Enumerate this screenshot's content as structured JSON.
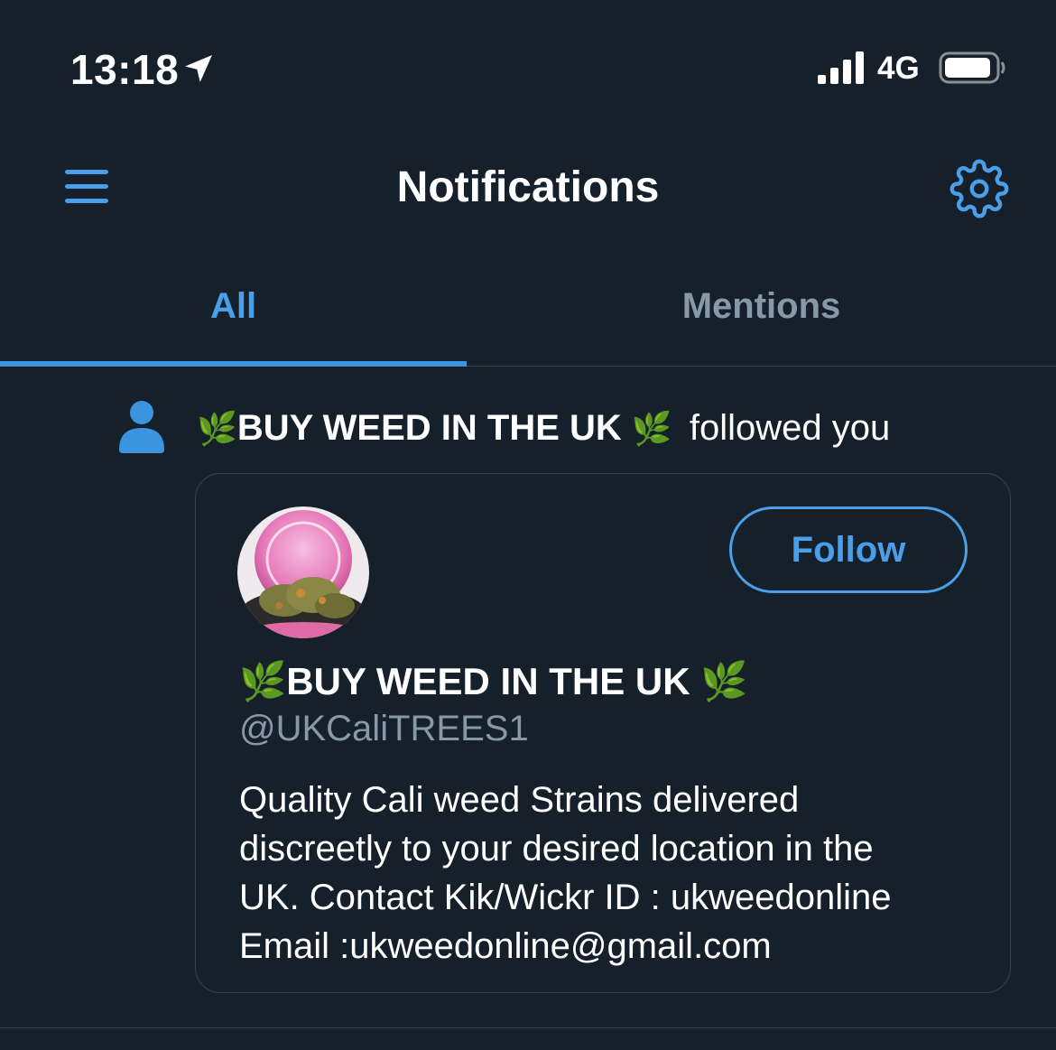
{
  "status_bar": {
    "time": "13:18",
    "network": "4G",
    "icons": [
      "location-arrow-icon",
      "signal-icon",
      "battery-icon"
    ]
  },
  "header": {
    "title": "Notifications",
    "icons": [
      "menu-icon",
      "gear-icon"
    ]
  },
  "tabs": [
    {
      "label": "All",
      "active": true
    },
    {
      "label": "Mentions",
      "active": false
    }
  ],
  "notification": {
    "icon": "person-icon",
    "leaf_left": "🌿",
    "name": "BUY WEED IN THE UK",
    "leaf_right": "🌿",
    "action": "followed you",
    "card": {
      "avatar": "avatar-image",
      "follow_label": "Follow",
      "display_name": "🌿BUY WEED IN THE UK 🌿",
      "handle": "@UKCaliTREES1",
      "bio_lines": [
        "Quality Cali weed Strains delivered",
        "discreetly to your desired location in the",
        "UK. Contact Kik/Wickr ID : ukweedonline",
        "Email :ukweedonline@gmail.com"
      ]
    }
  },
  "colors": {
    "background": "#15202b",
    "accent": "#4a9fe8",
    "muted_text": "#8899a6",
    "divider": "#38444d"
  }
}
